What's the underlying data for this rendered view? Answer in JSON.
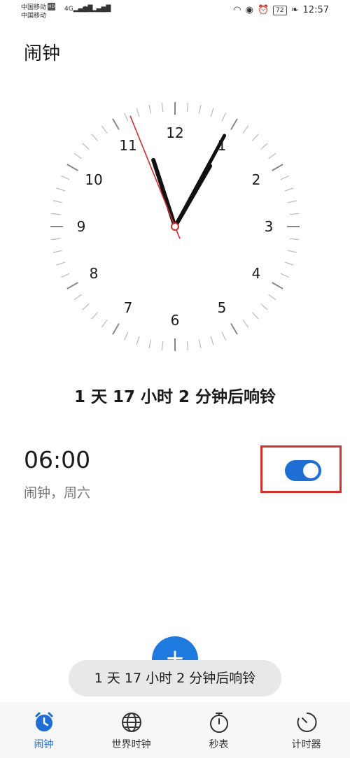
{
  "status_bar": {
    "carrier1": "中国移动",
    "carrier2": "中国移动",
    "hd": "HD",
    "signal1": "4G",
    "signal2": "4G",
    "battery": "72",
    "time": "12:57"
  },
  "page_title": "闹钟",
  "clock": {
    "numbers": [
      "12",
      "1",
      "2",
      "3",
      "4",
      "5",
      "6",
      "7",
      "8",
      "9",
      "10",
      "11"
    ],
    "hour_hand_time": "12:57"
  },
  "countdown_text": "1 天 17 小时 2 分钟后响铃",
  "alarm": {
    "time": "06:00",
    "label": "闹钟，周六",
    "enabled": true
  },
  "fab_label": "+",
  "toast_text": "1 天 17 小时 2 分钟后响铃",
  "bottom_nav": [
    {
      "label": "闹钟",
      "icon": "alarm-clock-icon",
      "active": true
    },
    {
      "label": "世界时钟",
      "icon": "globe-icon",
      "active": false
    },
    {
      "label": "秒表",
      "icon": "stopwatch-icon",
      "active": false
    },
    {
      "label": "计时器",
      "icon": "timer-icon",
      "active": false
    }
  ],
  "colors": {
    "accent": "#1f6ed4",
    "second_hand": "#d22b2b",
    "highlight": "#d0312d"
  }
}
